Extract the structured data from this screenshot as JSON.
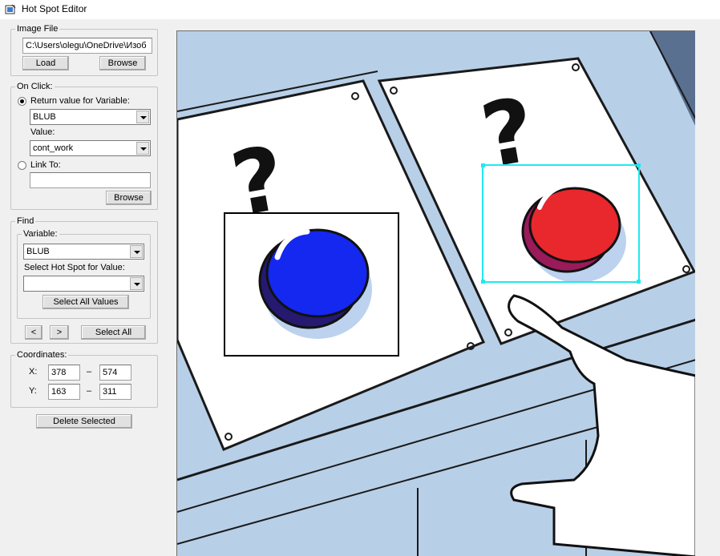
{
  "window": {
    "title": "Hot Spot Editor"
  },
  "image_file": {
    "legend": "Image File",
    "path": "C:\\Users\\olegu\\OneDrive\\Изоб",
    "load_label": "Load",
    "browse_label": "Browse"
  },
  "on_click": {
    "legend": "On Click:",
    "return_value_label": "Return value for Variable:",
    "variable_value": "BLUB",
    "value_label": "Value:",
    "value_value": "cont_work",
    "link_to_label": "Link To:",
    "link_to_value": "",
    "browse_label": "Browse"
  },
  "find": {
    "legend": "Find",
    "variable_label": "Variable:",
    "variable_value": "BLUB",
    "select_hotspot_label": "Select Hot Spot for Value:",
    "select_hotspot_value": "",
    "select_all_values_label": "Select All Values",
    "prev_label": "<",
    "next_label": ">",
    "select_all_label": "Select All"
  },
  "coordinates": {
    "legend": "Coordinates:",
    "x_label": "X:",
    "x1": "378",
    "x2": "574",
    "y_label": "Y:",
    "y1": "163",
    "y2": "311",
    "dash": "–"
  },
  "delete_selected_label": "Delete Selected",
  "colors": {
    "background": "#b8cfe8",
    "selected_outline": "#20e8f0",
    "other_outline": "#000000",
    "blue_button": "#1428f0",
    "red_button": "#e8282c"
  }
}
